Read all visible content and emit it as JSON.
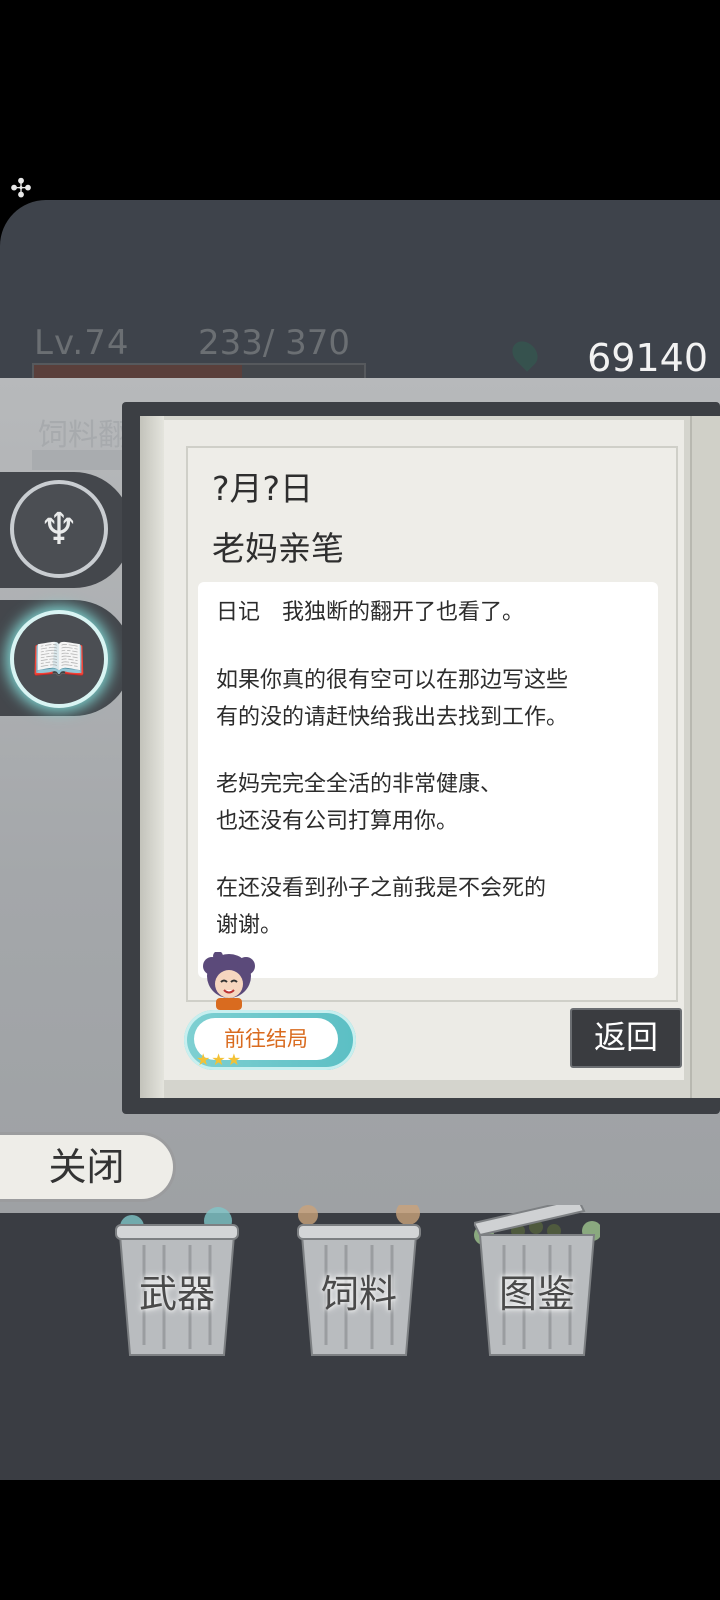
{
  "hud": {
    "level": "Lv.74",
    "xp": "233/  370",
    "xp_fraction": 0.63,
    "coins": "69140",
    "feed_ghost_label": "饲料翻"
  },
  "diary": {
    "date": "?月?日",
    "author": "老妈亲笔",
    "paragraphs": [
      "日记　我独断的翻开了也看了。",
      "如果你真的很有空可以在那边写这些\n有的没的请赶快给我出去找到工作。",
      "老妈完完全全活的非常健康、\n也还没有公司打算用你。",
      "在还没看到孙子之前我是不会死的\n谢谢。"
    ],
    "ending_button": "前往结局",
    "back_button": "返回"
  },
  "close_button": "关闭",
  "bins": [
    {
      "label": "武器",
      "accent": "#7fc6c8"
    },
    {
      "label": "饲料",
      "accent": "#c9a37a"
    },
    {
      "label": "图鉴",
      "accent": "#9fc48f"
    }
  ],
  "colors": {
    "background": "#3e434b",
    "glow": "#7fd3d0",
    "ending_text": "#d96b1f"
  }
}
